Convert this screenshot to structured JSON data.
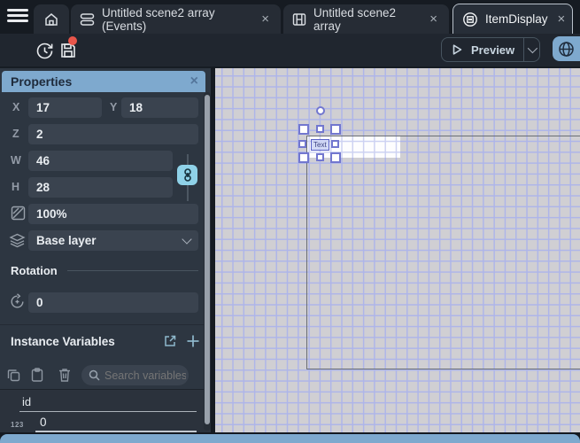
{
  "tabbar": {
    "tabs": [
      {
        "label": "Untitled scene2 array (Events)",
        "close_label": "×"
      },
      {
        "label": "Untitled scene2 array",
        "close_label": "×"
      },
      {
        "label": "ItemDisplay",
        "close_label": "×"
      }
    ]
  },
  "toolbar": {
    "preview_label": "Preview"
  },
  "properties": {
    "title": "Properties",
    "close_label": "×",
    "fields": {
      "x": {
        "label": "X",
        "value": "17"
      },
      "y": {
        "label": "Y",
        "value": "18"
      },
      "z": {
        "label": "Z",
        "value": "2"
      },
      "w": {
        "label": "W",
        "value": "46"
      },
      "h": {
        "label": "H",
        "value": "28"
      },
      "opacity": {
        "value": "100%"
      },
      "layer": {
        "value": "Base layer"
      },
      "rotation": {
        "value": "0"
      }
    },
    "rotation_section_title": "Rotation",
    "instance_variables": {
      "title": "Instance Variables",
      "search_placeholder": "Search variables",
      "rows": [
        {
          "name": "id",
          "type_badge": "123",
          "value": "0"
        }
      ]
    }
  },
  "canvas": {
    "selected_object_text": "Text"
  },
  "colors": {
    "accent_blue": "#7ea9ce",
    "link_badge": "#8fd2e8",
    "selection": "#7277cf",
    "unsaved_dot": "#e8564b",
    "grid_line": "#aeb5e9"
  }
}
